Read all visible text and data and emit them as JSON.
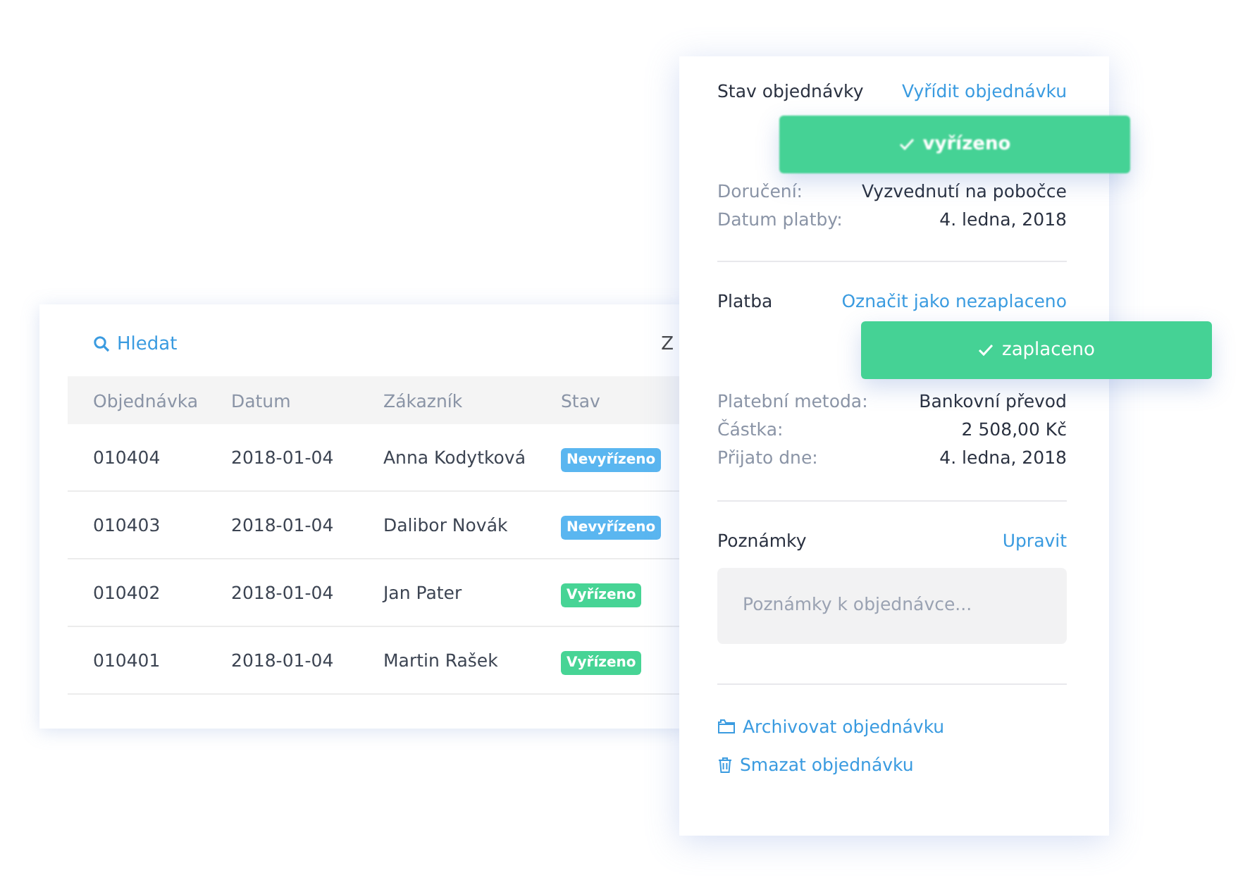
{
  "orders": {
    "search": "Hledat",
    "toolbar_cut_text": "Z",
    "columns": [
      "Objednávka",
      "Datum",
      "Zákazník",
      "Stav"
    ],
    "rows": [
      {
        "order": "010404",
        "date": "2018-01-04",
        "customer": "Anna Kodytková",
        "status": "Nevyřízeno",
        "color": "#5ab6f0"
      },
      {
        "order": "010403",
        "date": "2018-01-04",
        "customer": "Dalibor Novák",
        "status": "Nevyřízeno",
        "color": "#5ab6f0"
      },
      {
        "order": "010402",
        "date": "2018-01-04",
        "customer": "Jan Pater",
        "status": "Vyřízeno",
        "color": "#47d495"
      },
      {
        "order": "010401",
        "date": "2018-01-04",
        "customer": "Martin Rašek",
        "status": "Vyřízeno",
        "color": "#47d495"
      }
    ]
  },
  "detail": {
    "sections": [
      {
        "title": "Stav objednávky",
        "action": "Vyřídit objednávku",
        "button": {
          "label": "vyřízeno",
          "blurred": true
        },
        "fields": [
          {
            "label": "Doručení:",
            "value": "Vyzvednutí na pobočce"
          },
          {
            "label": "Datum platby:",
            "value": "4. ledna, 2018"
          }
        ]
      },
      {
        "title": "Platba",
        "action": "Označit jako nezaplaceno",
        "button": {
          "label": "zaplaceno",
          "blurred": false
        },
        "fields": [
          {
            "label": "Platební metoda:",
            "value": "Bankovní převod"
          },
          {
            "label": "Částka:",
            "value": "2 508,00 Kč"
          },
          {
            "label": "Přijato dne:",
            "value": "4. ledna, 2018"
          }
        ]
      }
    ],
    "notes": {
      "title": "Poznámky",
      "action": "Upravit",
      "placeholder": "Poznámky k objednávce..."
    },
    "links": [
      {
        "kind": "archive",
        "label": "Archivovat objednávku"
      },
      {
        "kind": "delete",
        "label": "Smazat objednávku"
      }
    ]
  }
}
